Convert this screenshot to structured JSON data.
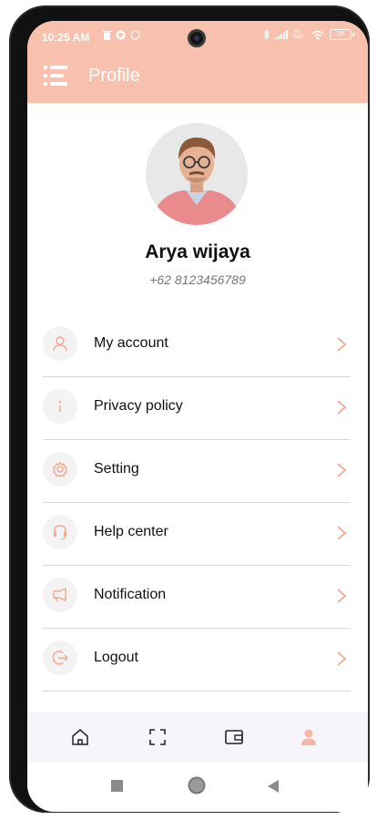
{
  "status_bar": {
    "time": "10:25 AM",
    "battery": "28",
    "network": "Vo WiFi"
  },
  "app_bar": {
    "title": "Profile",
    "menu_icon": "menu-icon"
  },
  "profile": {
    "name": "Arya wijaya",
    "phone": "+62 8123456789"
  },
  "menu": {
    "items": [
      {
        "label": "My account",
        "icon": "user-icon"
      },
      {
        "label": "Privacy policy",
        "icon": "info-icon"
      },
      {
        "label": "Setting",
        "icon": "gear-icon"
      },
      {
        "label": "Help center",
        "icon": "headset-icon"
      },
      {
        "label": "Notification",
        "icon": "megaphone-icon"
      },
      {
        "label": "Logout",
        "icon": "logout-icon"
      }
    ]
  },
  "bottom_nav": {
    "items": [
      {
        "icon": "home-icon",
        "active": false
      },
      {
        "icon": "scan-icon",
        "active": false
      },
      {
        "icon": "wallet-icon",
        "active": false
      },
      {
        "icon": "profile-icon",
        "active": true
      }
    ]
  },
  "colors": {
    "accent": "#f8c1ad",
    "icon_tint": "#f0a88f",
    "active_nav": "#f4b7a3"
  }
}
